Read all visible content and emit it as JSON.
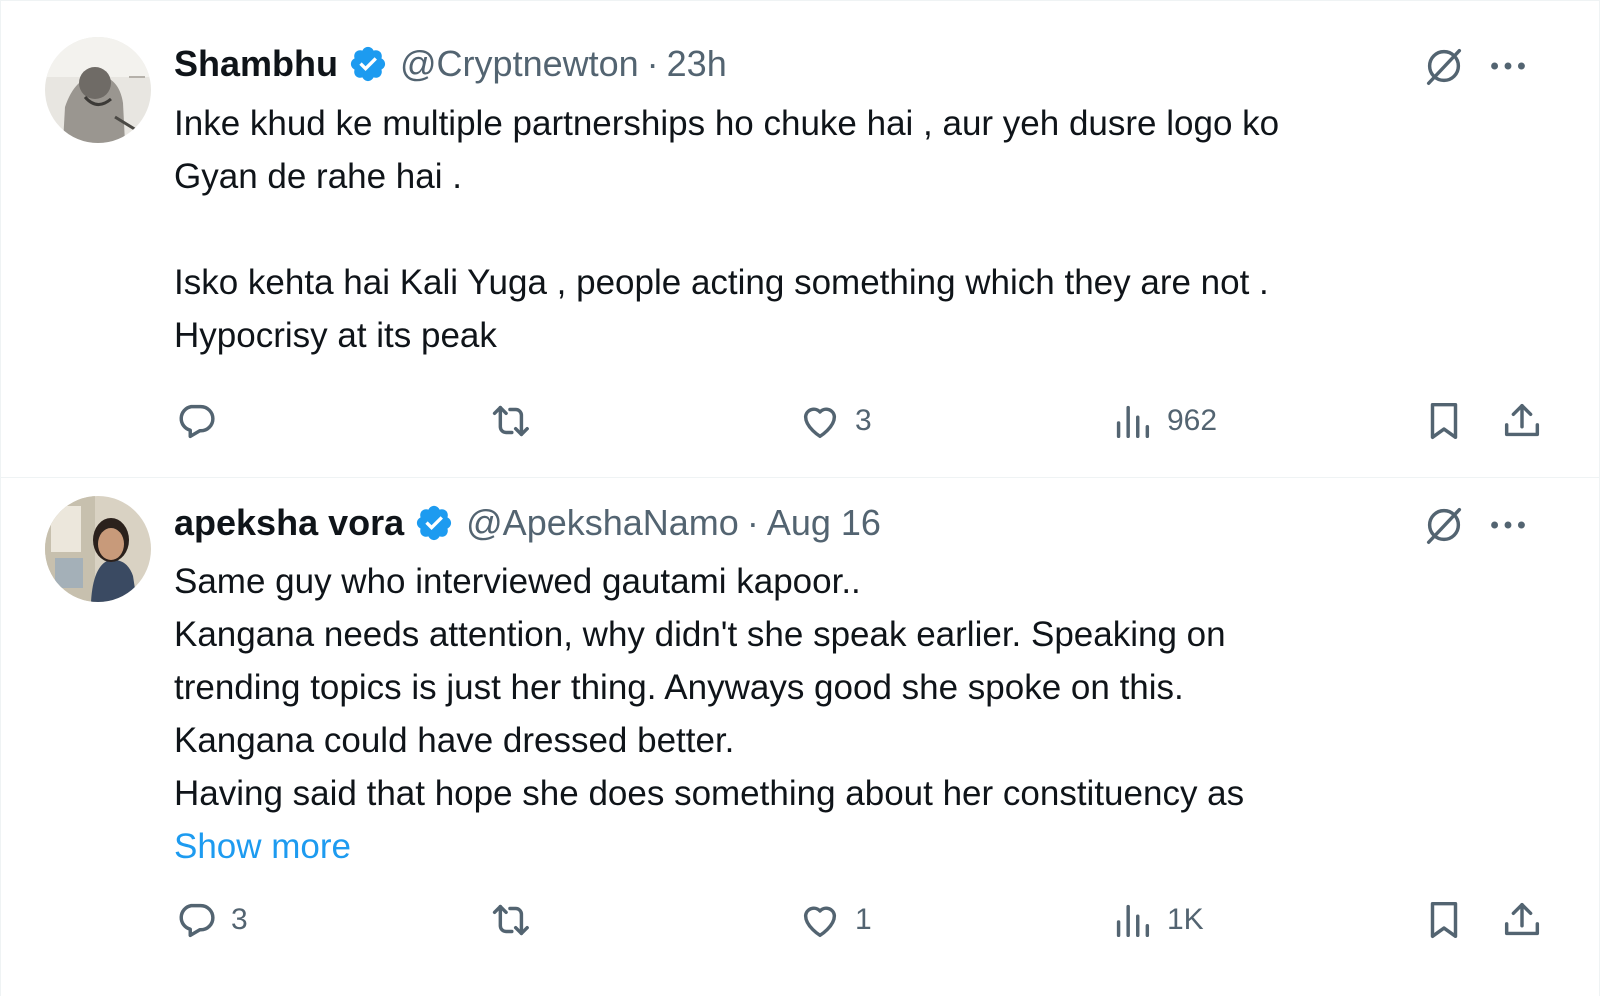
{
  "tweets": [
    {
      "display_name": "Shambhu",
      "handle": "@Cryptnewton",
      "separator": "·",
      "time": "23h",
      "text_lines": [
        "Inke khud ke multiple partnerships ho chuke hai , aur yeh dusre logo ko",
        "Gyan de rahe hai .",
        "",
        "Isko kehta hai Kali Yuga , people acting something which they are not .",
        "Hypocrisy at its peak"
      ],
      "show_more": "",
      "replies": "",
      "retweets": "",
      "likes": "3",
      "views": "962",
      "avatar_icon": "avatar-sketch-portrait"
    },
    {
      "display_name": "apeksha vora",
      "handle": "@ApekshaNamo",
      "separator": "·",
      "time": "Aug 16",
      "text_lines": [
        "Same guy who interviewed gautami kapoor..",
        "Kangana needs attention, why didn't she speak earlier. Speaking on",
        "trending topics is just her thing. Anyways good she spoke on this.",
        "Kangana could have dressed better.",
        "Having said that hope she does something about her constituency as"
      ],
      "show_more": "Show more",
      "replies": "3",
      "retweets": "",
      "likes": "1",
      "views": "1K",
      "avatar_icon": "avatar-photo-woman"
    }
  ],
  "icons": {
    "verified": "verified-badge-icon",
    "grok": "grok-icon",
    "more": "more-icon",
    "reply": "reply-icon",
    "retweet": "retweet-icon",
    "like": "heart-icon",
    "views": "views-icon",
    "bookmark": "bookmark-icon",
    "share": "share-icon"
  },
  "colors": {
    "text": "#0f1419",
    "secondary": "#536471",
    "accent": "#1d9bf0",
    "divider": "#eff3f4"
  }
}
